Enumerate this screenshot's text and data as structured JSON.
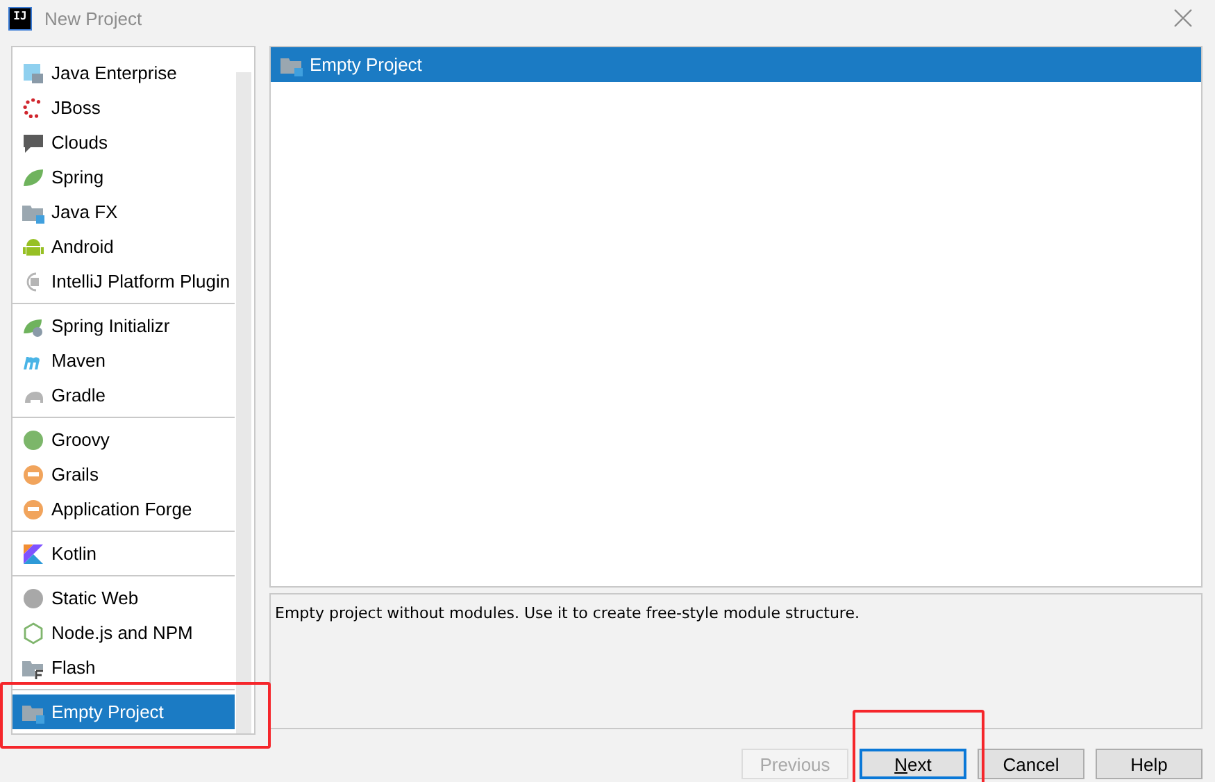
{
  "window": {
    "logo": "IJ",
    "title": "New Project"
  },
  "sidebar": {
    "groups": [
      {
        "items": [
          {
            "label": "Java Enterprise",
            "selected": false
          },
          {
            "label": "JBoss",
            "selected": false
          },
          {
            "label": "Clouds",
            "selected": false
          },
          {
            "label": "Spring",
            "selected": false
          },
          {
            "label": "Java FX",
            "selected": false
          },
          {
            "label": "Android",
            "selected": false
          },
          {
            "label": "IntelliJ Platform Plugin",
            "selected": false
          }
        ]
      },
      {
        "items": [
          {
            "label": "Spring Initializr",
            "selected": false
          },
          {
            "label": "Maven",
            "selected": false
          },
          {
            "label": "Gradle",
            "selected": false
          }
        ]
      },
      {
        "items": [
          {
            "label": "Groovy",
            "selected": false
          },
          {
            "label": "Grails",
            "selected": false
          },
          {
            "label": "Application Forge",
            "selected": false
          }
        ]
      },
      {
        "items": [
          {
            "label": "Kotlin",
            "selected": false
          }
        ]
      },
      {
        "items": [
          {
            "label": "Static Web",
            "selected": false
          },
          {
            "label": "Node.js and NPM",
            "selected": false
          },
          {
            "label": "Flash",
            "selected": false
          }
        ]
      },
      {
        "items": [
          {
            "label": "Empty Project",
            "selected": true,
            "annotated": true
          }
        ]
      }
    ]
  },
  "templates": [
    {
      "label": "Empty Project",
      "selected": true
    }
  ],
  "description": "Empty project without modules. Use it to create free-style module structure.",
  "buttons": [
    {
      "label": "Previous",
      "disabled": true,
      "default": false,
      "annotated": false
    },
    {
      "label": "Next",
      "disabled": false,
      "default": true,
      "annotated": true
    },
    {
      "label": "Cancel",
      "disabled": false,
      "default": false,
      "annotated": false
    },
    {
      "label": "Help",
      "disabled": false,
      "default": false,
      "annotated": false
    }
  ]
}
